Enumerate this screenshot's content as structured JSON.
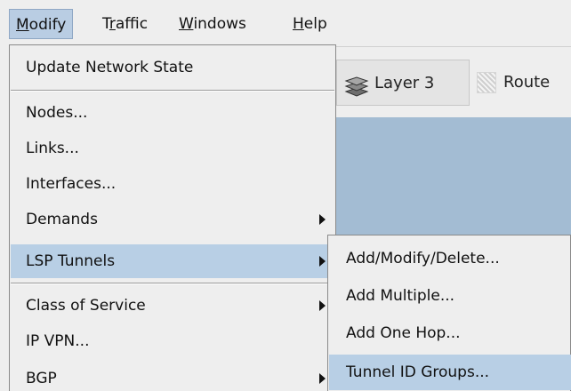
{
  "menubar": {
    "items": [
      {
        "pre": "",
        "u": "M",
        "post": "odify"
      },
      {
        "pre": "T",
        "u": "r",
        "post": "affic"
      },
      {
        "pre": "",
        "u": "W",
        "post": "indows"
      },
      {
        "pre": "",
        "u": "H",
        "post": "elp"
      }
    ]
  },
  "toolbar": {
    "layer_label": "Layer 3",
    "route_label": "Route",
    "layer_icon": "layers-icon",
    "route_icon": "route-icon"
  },
  "modify_menu": {
    "items": [
      {
        "label": "Update Network State",
        "submenu": false
      },
      {
        "label": "Nodes...",
        "submenu": false
      },
      {
        "label": "Links...",
        "submenu": false
      },
      {
        "label": "Interfaces...",
        "submenu": false
      },
      {
        "label": "Demands",
        "submenu": true
      },
      {
        "label": "LSP Tunnels",
        "submenu": true,
        "selected": true
      },
      {
        "label": "Class of Service",
        "submenu": true
      },
      {
        "label": "IP VPN...",
        "submenu": false
      },
      {
        "label": "BGP",
        "submenu": true
      }
    ]
  },
  "lsp_submenu": {
    "items": [
      {
        "label": "Add/Modify/Delete..."
      },
      {
        "label": "Add Multiple..."
      },
      {
        "label": "Add One Hop..."
      },
      {
        "label": "Tunnel ID Groups...",
        "selected": true
      }
    ]
  },
  "colors": {
    "menu_background": "#eeeeee",
    "selection": "#b8cfe5",
    "canvas": "#a3bcd3"
  }
}
